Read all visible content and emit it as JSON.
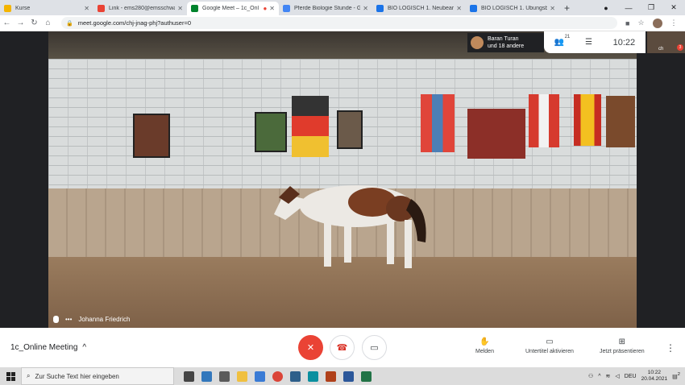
{
  "browser": {
    "tabs": [
      {
        "label": "Kurse",
        "color": "#f4b400",
        "active": false
      },
      {
        "label": "Link - ems280@emsschwaö",
        "color": "#ea4335",
        "active": false
      },
      {
        "label": "Google Meet – 1c_Onl",
        "color": "#00832d",
        "active": true
      },
      {
        "label": "Pferde Biologie Stunde - G",
        "color": "#4285f4",
        "active": false
      },
      {
        "label": "BIO LOGISCH 1. Neubearbe",
        "color": "#1a73e8",
        "active": false
      },
      {
        "label": "BIO LOGISCH 1. Übungsbu",
        "color": "#1a73e8",
        "active": false
      }
    ],
    "url": "meet.google.com/chj-jnag-phj?authuser=0"
  },
  "meeting": {
    "participant_name": "Baran Turan",
    "participant_others": "und 18 andere",
    "people_count": "21",
    "time": "10:22",
    "speaker_name": "Johanna Friedrich",
    "self_view_name": "ch",
    "notification_count": "3",
    "meeting_name": "1c_Online Meeting",
    "actions": {
      "raise_hand": "Melden",
      "captions": "Untertitel aktivieren",
      "present": "Jetzt präsentieren"
    }
  },
  "taskbar": {
    "search_placeholder": "Zur Suche Text hier eingeben",
    "language": "DEU",
    "clock_time": "10:22",
    "clock_date": "20.04.2021",
    "notification_badge": "2"
  },
  "colors": {
    "mic_off": "#ea4335",
    "hangup": "#d93025",
    "accent": "#1a73e8"
  }
}
